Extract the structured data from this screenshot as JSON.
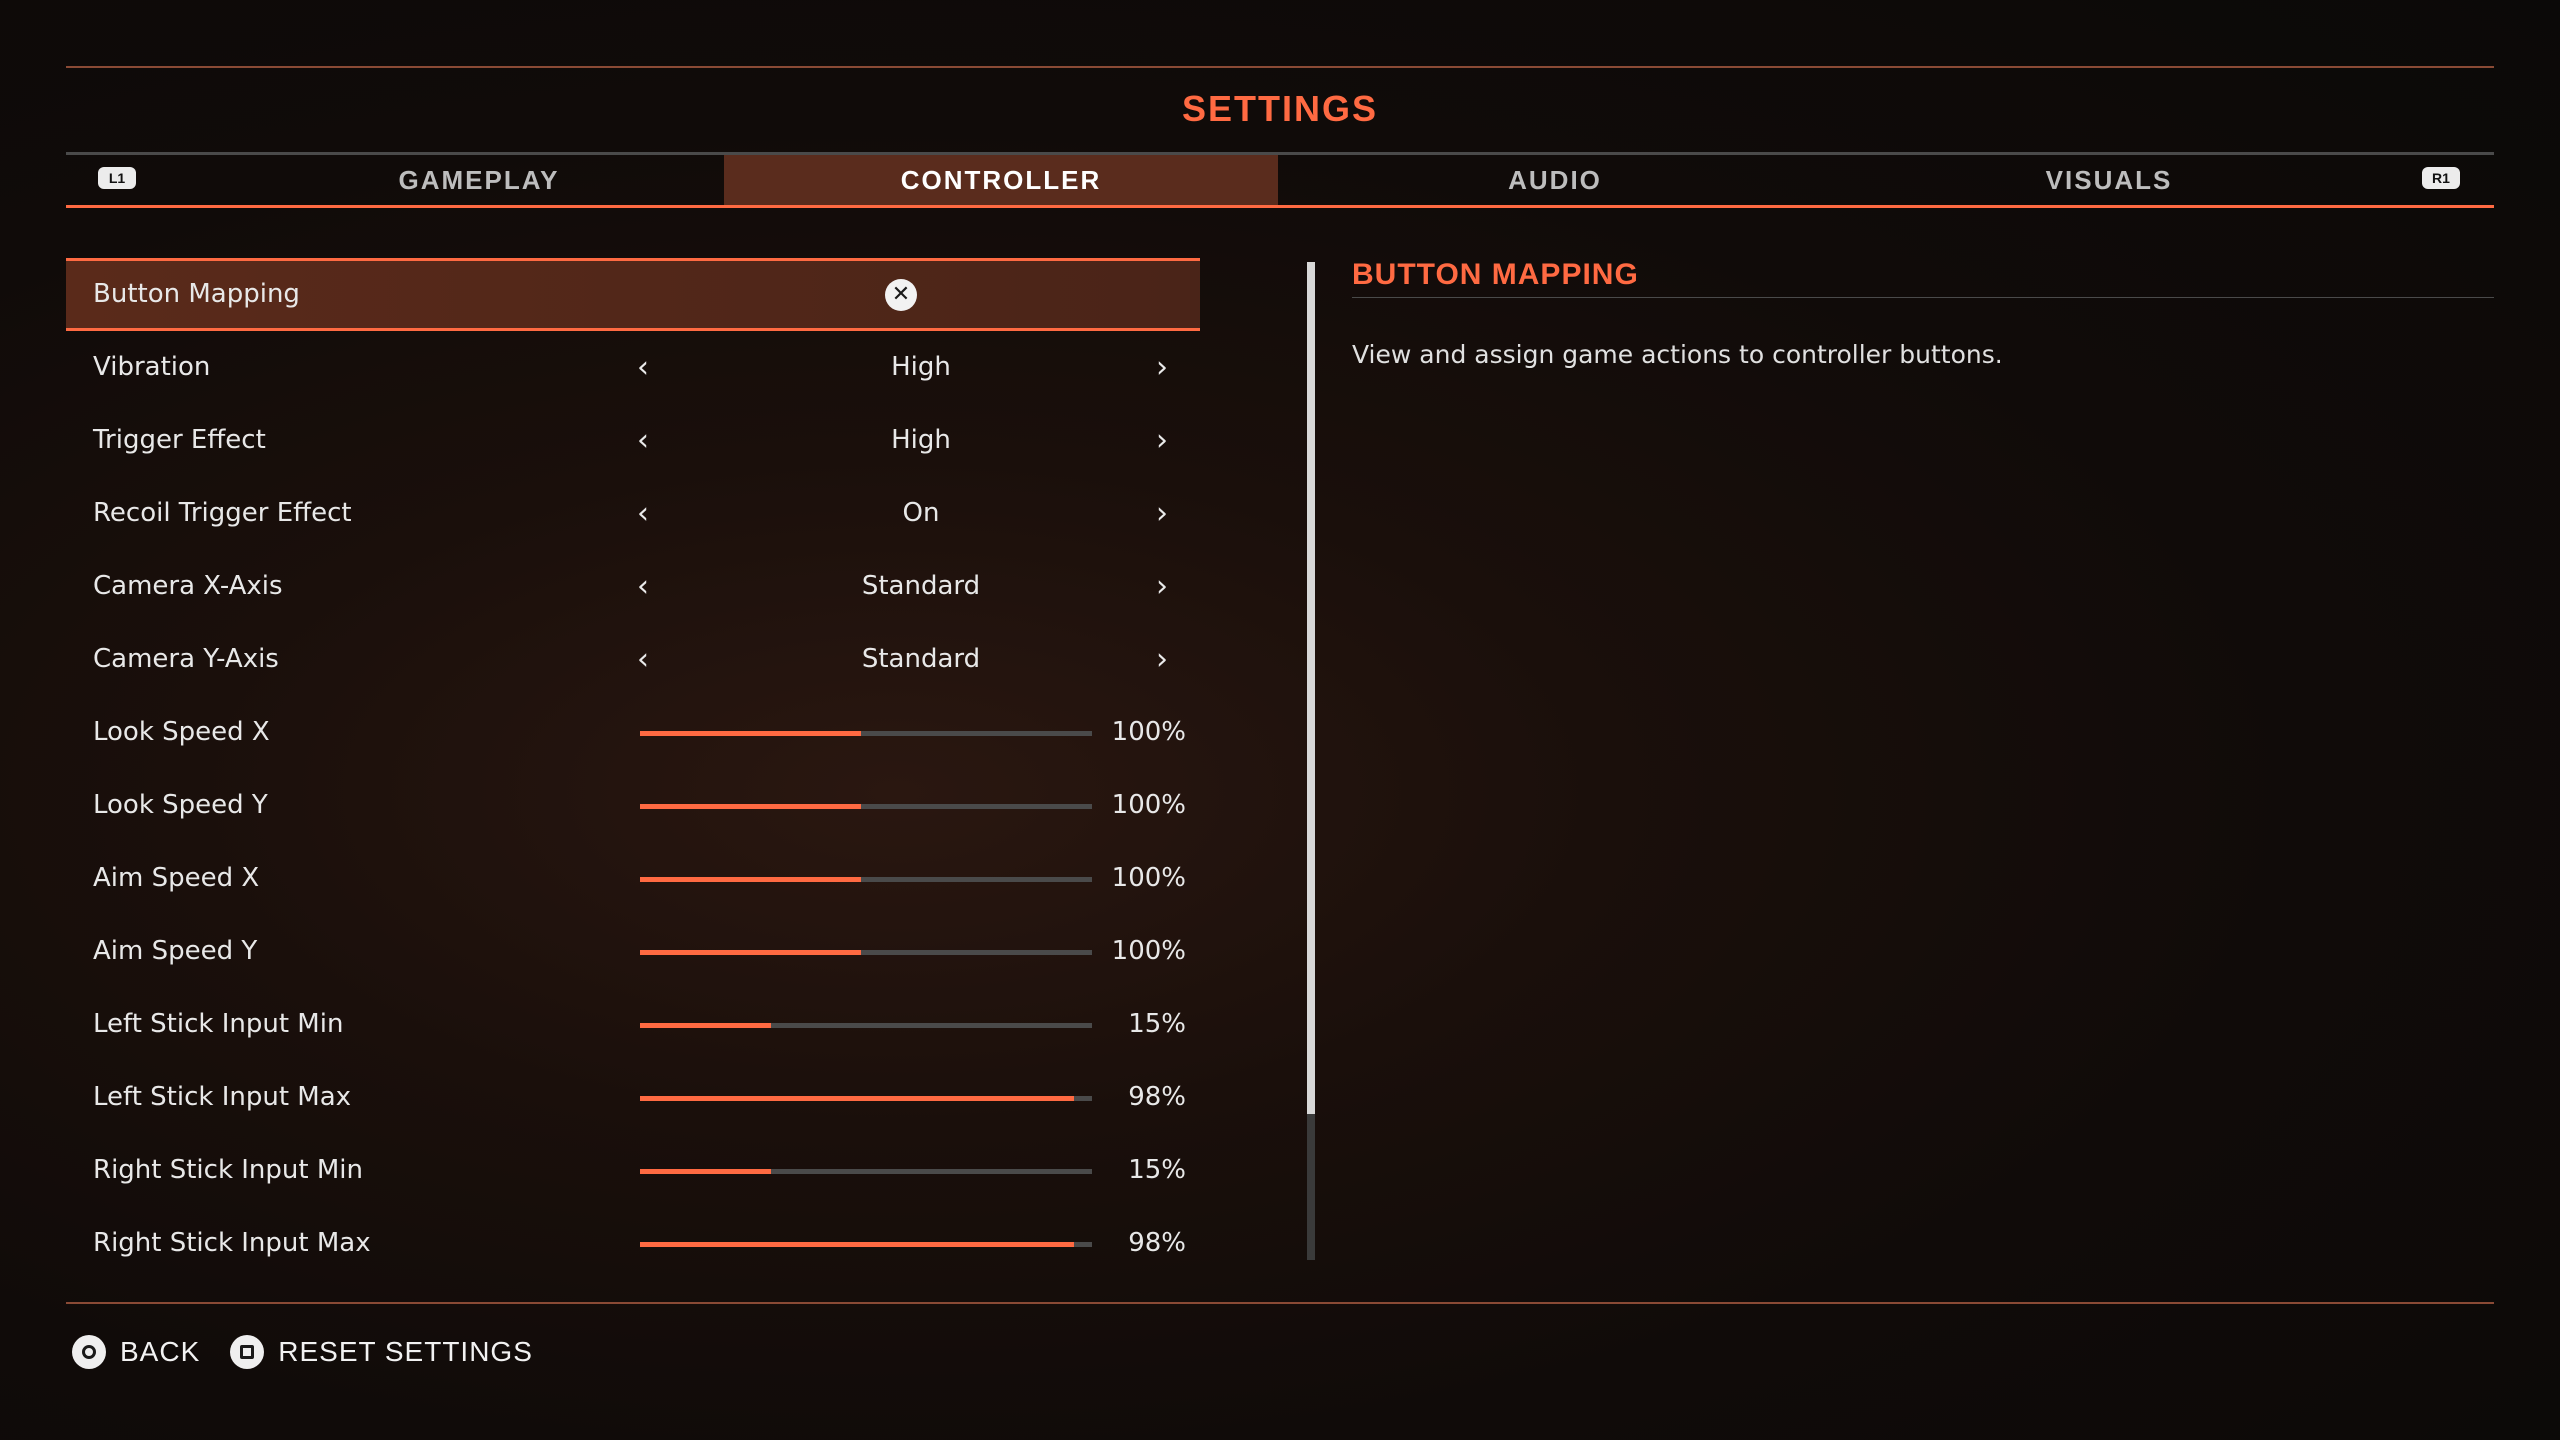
{
  "header": {
    "title": "SETTINGS",
    "left_bumper": "L1",
    "right_bumper": "R1"
  },
  "tabs": [
    {
      "label": "GAMEPLAY",
      "active": false
    },
    {
      "label": "CONTROLLER",
      "active": true
    },
    {
      "label": "AUDIO",
      "active": false
    },
    {
      "label": "VISUALS",
      "active": false
    }
  ],
  "settings": [
    {
      "label": "Button Mapping",
      "type": "button",
      "icon": "close-x-icon",
      "selected": true
    },
    {
      "label": "Vibration",
      "type": "selector",
      "value": "High"
    },
    {
      "label": "Trigger Effect",
      "type": "selector",
      "value": "High"
    },
    {
      "label": "Recoil Trigger Effect",
      "type": "selector",
      "value": "On"
    },
    {
      "label": "Camera X-Axis",
      "type": "selector",
      "value": "Standard"
    },
    {
      "label": "Camera Y-Axis",
      "type": "selector",
      "value": "Standard"
    },
    {
      "label": "Look Speed X",
      "type": "slider",
      "value": "100%",
      "fill": 0.49
    },
    {
      "label": "Look Speed Y",
      "type": "slider",
      "value": "100%",
      "fill": 0.49
    },
    {
      "label": "Aim Speed X",
      "type": "slider",
      "value": "100%",
      "fill": 0.49
    },
    {
      "label": "Aim Speed Y",
      "type": "slider",
      "value": "100%",
      "fill": 0.49
    },
    {
      "label": "Left Stick Input Min",
      "type": "slider",
      "value": "15%",
      "fill": 0.29
    },
    {
      "label": "Left Stick Input Max",
      "type": "slider",
      "value": "98%",
      "fill": 0.96
    },
    {
      "label": "Right Stick Input Min",
      "type": "slider",
      "value": "15%",
      "fill": 0.29
    },
    {
      "label": "Right Stick Input Max",
      "type": "slider",
      "value": "98%",
      "fill": 0.96
    }
  ],
  "description": {
    "title": "BUTTON MAPPING",
    "text": "View and assign game actions to controller buttons."
  },
  "footer": {
    "back_label": "BACK",
    "reset_label": "RESET SETTINGS"
  },
  "colors": {
    "accent": "#ff6a42",
    "selected_bg": "#5a2c1d"
  }
}
